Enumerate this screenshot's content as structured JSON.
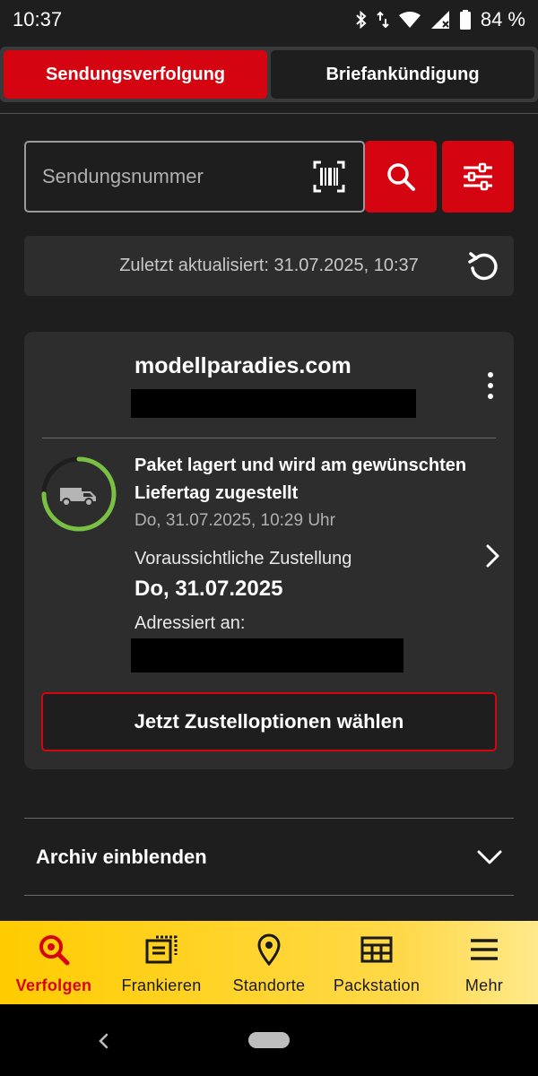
{
  "statusbar": {
    "time": "10:37",
    "battery": "84 %"
  },
  "tabs": [
    {
      "label": "Sendungsverfolgung",
      "active": true
    },
    {
      "label": "Briefankündigung",
      "active": false
    }
  ],
  "search": {
    "placeholder": "Sendungsnummer",
    "value": ""
  },
  "update": {
    "text": "Zuletzt aktualisiert: 31.07.2025, 10:37"
  },
  "shipment": {
    "sender": "modellparadies.com",
    "status_title": "Paket lagert und wird am gewünschten Liefertag zugestellt",
    "status_date": "Do, 31.07.2025, 10:29 Uhr",
    "eta_label": "Voraussichtliche Zustellung",
    "eta_date": "Do, 31.07.2025",
    "address_label": "Adressiert an:",
    "action_label": "Jetzt Zustelloptionen wählen",
    "progress": 0.75
  },
  "archive": {
    "label": "Archiv einblenden"
  },
  "bottom_nav": [
    {
      "label": "Verfolgen",
      "icon": "search-track-icon",
      "active": true
    },
    {
      "label": "Frankieren",
      "icon": "stamp-icon",
      "active": false
    },
    {
      "label": "Standorte",
      "icon": "location-pin-icon",
      "active": false
    },
    {
      "label": "Packstation",
      "icon": "packstation-icon",
      "active": false
    },
    {
      "label": "Mehr",
      "icon": "menu-icon",
      "active": false
    }
  ],
  "colors": {
    "accent": "#d40511",
    "nav_bg": "#ffcc00",
    "progress": "#7ac143",
    "background": "#1e1e1e",
    "card": "#2d2d2d"
  }
}
